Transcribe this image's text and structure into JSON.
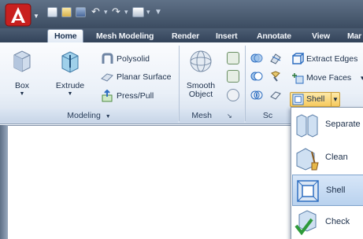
{
  "tabs": [
    {
      "label": "Home",
      "active": true
    },
    {
      "label": "Mesh Modeling"
    },
    {
      "label": "Render"
    },
    {
      "label": "Insert"
    },
    {
      "label": "Annotate"
    },
    {
      "label": "View"
    },
    {
      "label": "Mar"
    }
  ],
  "modeling": {
    "title": "Modeling",
    "box_label": "Box",
    "extrude_label": "Extrude",
    "polysolid_label": "Polysolid",
    "planar_surface_label": "Planar Surface",
    "presspull_label": "Press/Pull"
  },
  "mesh": {
    "title": "Mesh",
    "smooth_label_1": "Smooth",
    "smooth_label_2": "Object"
  },
  "solid_editing": {
    "title_partial": "Sc",
    "extract_edges_label": "Extract Edges",
    "move_faces_label": "Move Faces",
    "shell_label": "Shell"
  },
  "dropdown": {
    "items": [
      {
        "label": "Separate"
      },
      {
        "label": "Clean"
      },
      {
        "label": "Shell",
        "selected": true
      },
      {
        "label": "Check"
      }
    ]
  },
  "icons": {
    "app_logo": "autocad-logo-icon",
    "box": "box-icon",
    "extrude": "extrude-icon"
  },
  "colors": {
    "accent_blue": "#2f6fc1",
    "logo_red": "#c8201f",
    "highlight_orange": "#f6c95e"
  }
}
